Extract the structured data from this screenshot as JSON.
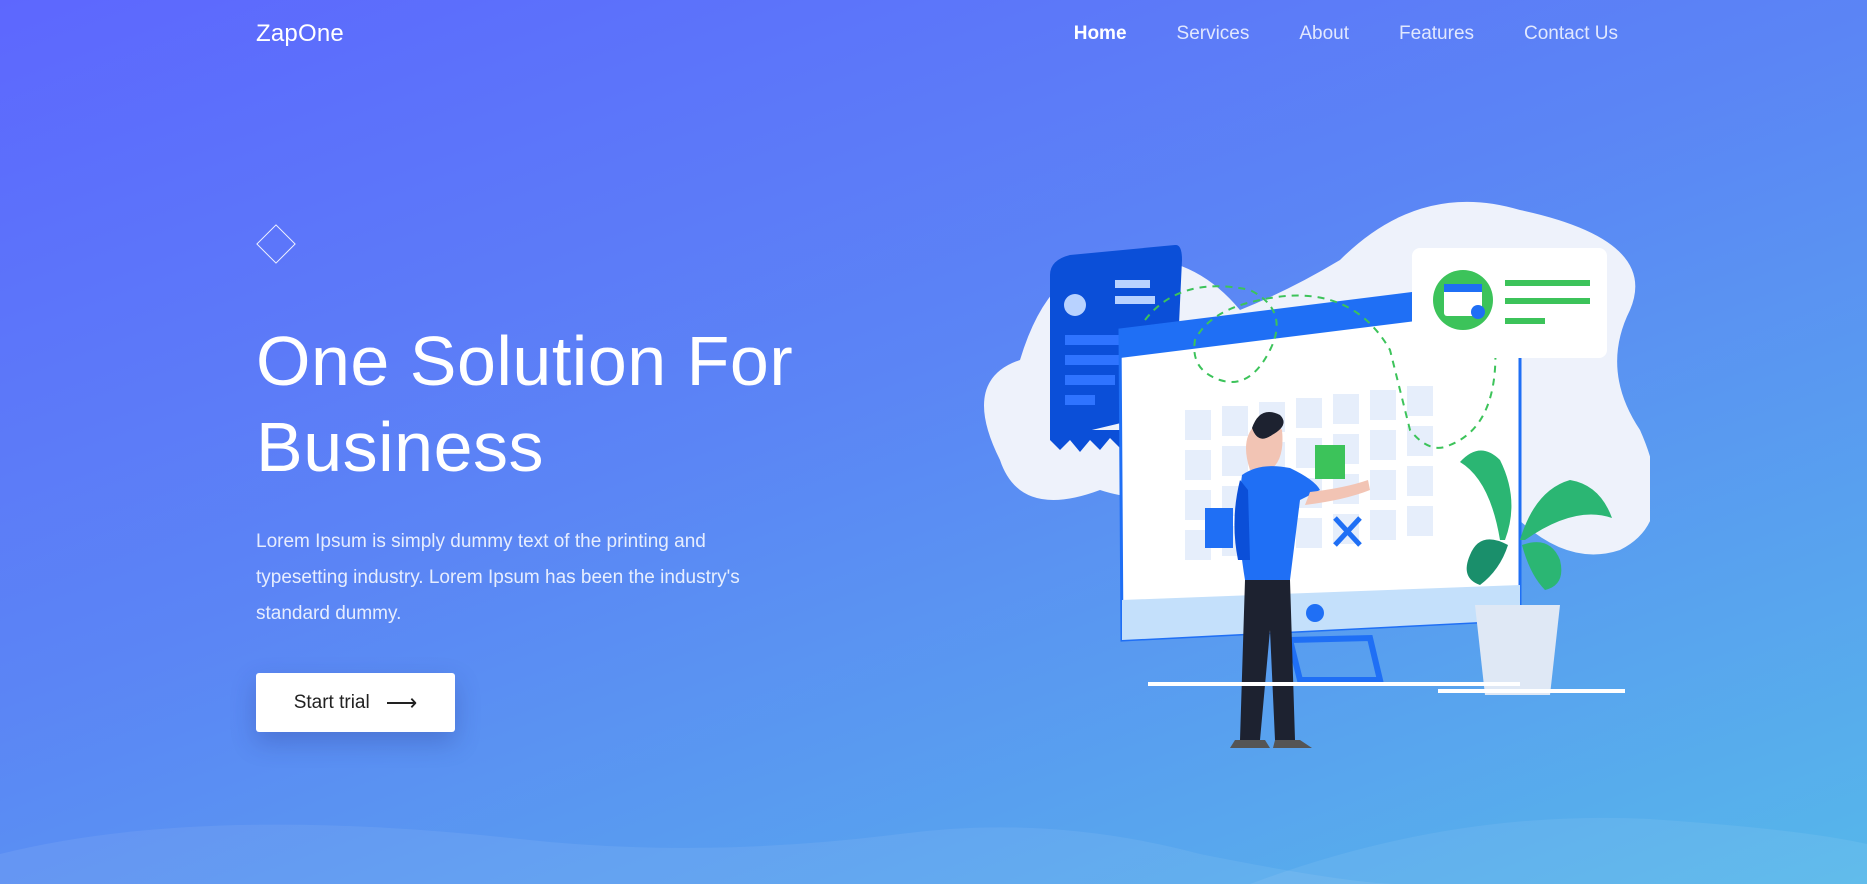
{
  "nav": {
    "brand": "ZapOne",
    "links": [
      {
        "label": "Home",
        "active": true
      },
      {
        "label": "Services",
        "active": false
      },
      {
        "label": "About",
        "active": false
      },
      {
        "label": "Features",
        "active": false
      },
      {
        "label": "Contact Us",
        "active": false
      }
    ]
  },
  "hero": {
    "title_line1": "One Solution For",
    "title_line2": "Business",
    "text": "Lorem Ipsum is simply dummy text of the printing and typesetting industry. Lorem Ipsum has been the industry's standard dummy.",
    "cta_label": "Start trial",
    "cta_icon": "arrow-right-icon"
  },
  "colors": {
    "gradient_start": "#5d67fe",
    "gradient_end": "#56b7ea",
    "accent_blue": "#1f6ff5",
    "accent_green": "#3cc35a"
  }
}
